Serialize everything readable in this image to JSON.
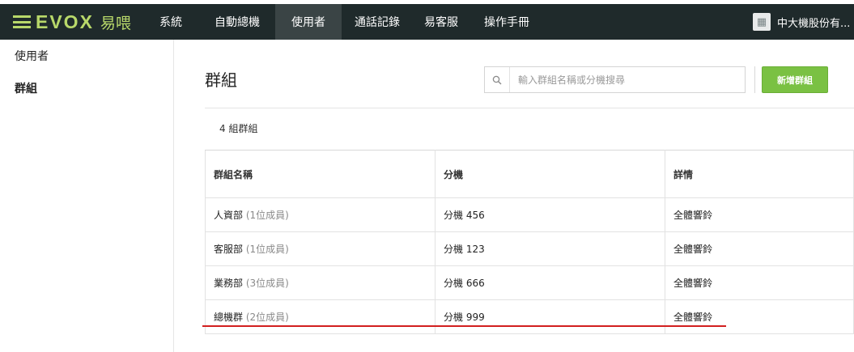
{
  "header": {
    "logo": "EVOX",
    "logo_sub": "易喂",
    "nav": [
      {
        "label": "系統"
      },
      {
        "label": "自動總機"
      },
      {
        "label": "使用者",
        "active": true
      },
      {
        "label": "通話記錄"
      },
      {
        "label": "易客服"
      },
      {
        "label": "操作手冊"
      }
    ],
    "company": "中大機股份有..."
  },
  "sidebar": {
    "items": [
      {
        "label": "使用者"
      },
      {
        "label": "群組",
        "active": true
      }
    ]
  },
  "main": {
    "title": "群組",
    "search_placeholder": "輸入群組名稱或分機搜尋",
    "add_button": "新增群組",
    "count": "4 組群組",
    "table": {
      "headers": [
        "群組名稱",
        "分機",
        "詳情"
      ],
      "rows": [
        {
          "name": "人資部",
          "members": "(1位成員)",
          "ext": "分機 456",
          "detail": "全體響鈴"
        },
        {
          "name": "客服部",
          "members": "(1位成員)",
          "ext": "分機 123",
          "detail": "全體響鈴"
        },
        {
          "name": "業務部",
          "members": "(3位成員)",
          "ext": "分機 666",
          "detail": "全體響鈴"
        },
        {
          "name": "總機群",
          "members": "(2位成員)",
          "ext": "分機 999",
          "detail": "全體響鈴"
        }
      ]
    }
  },
  "colors": {
    "topbar": "#1f2a2b",
    "accent_green": "#7ac143",
    "logo_green": "#b8d86a",
    "annotation_red": "#d21f1f"
  }
}
